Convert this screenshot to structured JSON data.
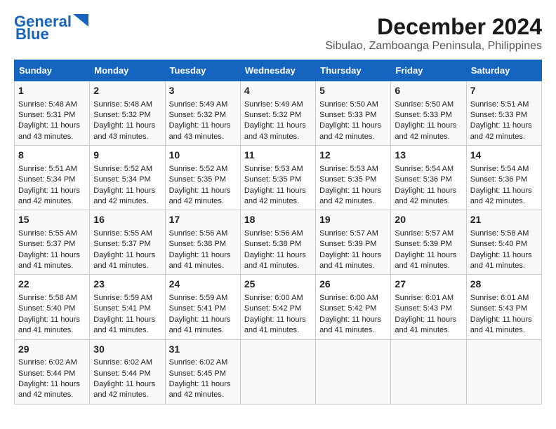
{
  "header": {
    "logo_line1": "General",
    "logo_line2": "Blue",
    "title": "December 2024",
    "subtitle": "Sibulao, Zamboanga Peninsula, Philippines"
  },
  "columns": [
    "Sunday",
    "Monday",
    "Tuesday",
    "Wednesday",
    "Thursday",
    "Friday",
    "Saturday"
  ],
  "weeks": [
    [
      {
        "day": "1",
        "lines": [
          "Sunrise: 5:48 AM",
          "Sunset: 5:31 PM",
          "Daylight: 11 hours",
          "and 43 minutes."
        ]
      },
      {
        "day": "2",
        "lines": [
          "Sunrise: 5:48 AM",
          "Sunset: 5:32 PM",
          "Daylight: 11 hours",
          "and 43 minutes."
        ]
      },
      {
        "day": "3",
        "lines": [
          "Sunrise: 5:49 AM",
          "Sunset: 5:32 PM",
          "Daylight: 11 hours",
          "and 43 minutes."
        ]
      },
      {
        "day": "4",
        "lines": [
          "Sunrise: 5:49 AM",
          "Sunset: 5:32 PM",
          "Daylight: 11 hours",
          "and 43 minutes."
        ]
      },
      {
        "day": "5",
        "lines": [
          "Sunrise: 5:50 AM",
          "Sunset: 5:33 PM",
          "Daylight: 11 hours",
          "and 42 minutes."
        ]
      },
      {
        "day": "6",
        "lines": [
          "Sunrise: 5:50 AM",
          "Sunset: 5:33 PM",
          "Daylight: 11 hours",
          "and 42 minutes."
        ]
      },
      {
        "day": "7",
        "lines": [
          "Sunrise: 5:51 AM",
          "Sunset: 5:33 PM",
          "Daylight: 11 hours",
          "and 42 minutes."
        ]
      }
    ],
    [
      {
        "day": "8",
        "lines": [
          "Sunrise: 5:51 AM",
          "Sunset: 5:34 PM",
          "Daylight: 11 hours",
          "and 42 minutes."
        ]
      },
      {
        "day": "9",
        "lines": [
          "Sunrise: 5:52 AM",
          "Sunset: 5:34 PM",
          "Daylight: 11 hours",
          "and 42 minutes."
        ]
      },
      {
        "day": "10",
        "lines": [
          "Sunrise: 5:52 AM",
          "Sunset: 5:35 PM",
          "Daylight: 11 hours",
          "and 42 minutes."
        ]
      },
      {
        "day": "11",
        "lines": [
          "Sunrise: 5:53 AM",
          "Sunset: 5:35 PM",
          "Daylight: 11 hours",
          "and 42 minutes."
        ]
      },
      {
        "day": "12",
        "lines": [
          "Sunrise: 5:53 AM",
          "Sunset: 5:35 PM",
          "Daylight: 11 hours",
          "and 42 minutes."
        ]
      },
      {
        "day": "13",
        "lines": [
          "Sunrise: 5:54 AM",
          "Sunset: 5:36 PM",
          "Daylight: 11 hours",
          "and 42 minutes."
        ]
      },
      {
        "day": "14",
        "lines": [
          "Sunrise: 5:54 AM",
          "Sunset: 5:36 PM",
          "Daylight: 11 hours",
          "and 42 minutes."
        ]
      }
    ],
    [
      {
        "day": "15",
        "lines": [
          "Sunrise: 5:55 AM",
          "Sunset: 5:37 PM",
          "Daylight: 11 hours",
          "and 41 minutes."
        ]
      },
      {
        "day": "16",
        "lines": [
          "Sunrise: 5:55 AM",
          "Sunset: 5:37 PM",
          "Daylight: 11 hours",
          "and 41 minutes."
        ]
      },
      {
        "day": "17",
        "lines": [
          "Sunrise: 5:56 AM",
          "Sunset: 5:38 PM",
          "Daylight: 11 hours",
          "and 41 minutes."
        ]
      },
      {
        "day": "18",
        "lines": [
          "Sunrise: 5:56 AM",
          "Sunset: 5:38 PM",
          "Daylight: 11 hours",
          "and 41 minutes."
        ]
      },
      {
        "day": "19",
        "lines": [
          "Sunrise: 5:57 AM",
          "Sunset: 5:39 PM",
          "Daylight: 11 hours",
          "and 41 minutes."
        ]
      },
      {
        "day": "20",
        "lines": [
          "Sunrise: 5:57 AM",
          "Sunset: 5:39 PM",
          "Daylight: 11 hours",
          "and 41 minutes."
        ]
      },
      {
        "day": "21",
        "lines": [
          "Sunrise: 5:58 AM",
          "Sunset: 5:40 PM",
          "Daylight: 11 hours",
          "and 41 minutes."
        ]
      }
    ],
    [
      {
        "day": "22",
        "lines": [
          "Sunrise: 5:58 AM",
          "Sunset: 5:40 PM",
          "Daylight: 11 hours",
          "and 41 minutes."
        ]
      },
      {
        "day": "23",
        "lines": [
          "Sunrise: 5:59 AM",
          "Sunset: 5:41 PM",
          "Daylight: 11 hours",
          "and 41 minutes."
        ]
      },
      {
        "day": "24",
        "lines": [
          "Sunrise: 5:59 AM",
          "Sunset: 5:41 PM",
          "Daylight: 11 hours",
          "and 41 minutes."
        ]
      },
      {
        "day": "25",
        "lines": [
          "Sunrise: 6:00 AM",
          "Sunset: 5:42 PM",
          "Daylight: 11 hours",
          "and 41 minutes."
        ]
      },
      {
        "day": "26",
        "lines": [
          "Sunrise: 6:00 AM",
          "Sunset: 5:42 PM",
          "Daylight: 11 hours",
          "and 41 minutes."
        ]
      },
      {
        "day": "27",
        "lines": [
          "Sunrise: 6:01 AM",
          "Sunset: 5:43 PM",
          "Daylight: 11 hours",
          "and 41 minutes."
        ]
      },
      {
        "day": "28",
        "lines": [
          "Sunrise: 6:01 AM",
          "Sunset: 5:43 PM",
          "Daylight: 11 hours",
          "and 41 minutes."
        ]
      }
    ],
    [
      {
        "day": "29",
        "lines": [
          "Sunrise: 6:02 AM",
          "Sunset: 5:44 PM",
          "Daylight: 11 hours",
          "and 42 minutes."
        ]
      },
      {
        "day": "30",
        "lines": [
          "Sunrise: 6:02 AM",
          "Sunset: 5:44 PM",
          "Daylight: 11 hours",
          "and 42 minutes."
        ]
      },
      {
        "day": "31",
        "lines": [
          "Sunrise: 6:02 AM",
          "Sunset: 5:45 PM",
          "Daylight: 11 hours",
          "and 42 minutes."
        ]
      },
      {
        "day": "",
        "lines": []
      },
      {
        "day": "",
        "lines": []
      },
      {
        "day": "",
        "lines": []
      },
      {
        "day": "",
        "lines": []
      }
    ]
  ]
}
